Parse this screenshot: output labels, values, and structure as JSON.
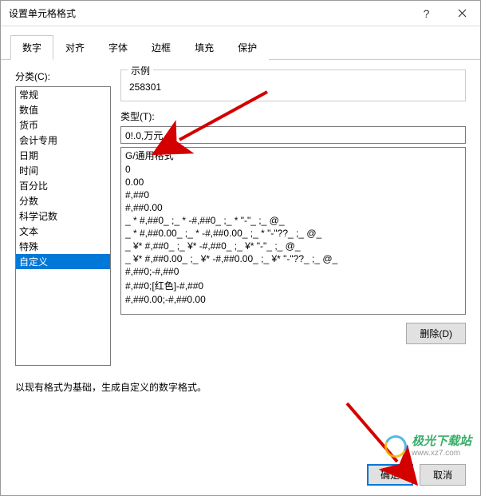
{
  "titlebar": {
    "title": "设置单元格格式"
  },
  "tabs": [
    {
      "label": "数字"
    },
    {
      "label": "对齐"
    },
    {
      "label": "字体"
    },
    {
      "label": "边框"
    },
    {
      "label": "填充"
    },
    {
      "label": "保护"
    }
  ],
  "category": {
    "label": "分类(C):",
    "items": [
      "常规",
      "数值",
      "货币",
      "会计专用",
      "日期",
      "时间",
      "百分比",
      "分数",
      "科学记数",
      "文本",
      "特殊",
      "自定义"
    ],
    "selected_index": 11
  },
  "sample": {
    "label": "示例",
    "value": "258301"
  },
  "type": {
    "label": "类型(T):",
    "value": "0!.0,万元"
  },
  "formats": [
    "G/通用格式",
    "0",
    "0.00",
    "#,##0",
    "#,##0.00",
    "_ * #,##0_ ;_ * -#,##0_ ;_ * \"-\"_ ;_ @_ ",
    "_ * #,##0.00_ ;_ * -#,##0.00_ ;_ * \"-\"??_ ;_ @_ ",
    "_ ¥* #,##0_ ;_ ¥* -#,##0_ ;_ ¥* \"-\"_ ;_ @_ ",
    "_ ¥* #,##0.00_ ;_ ¥* -#,##0.00_ ;_ ¥* \"-\"??_ ;_ @_ ",
    "#,##0;-#,##0",
    "#,##0;[红色]-#,##0",
    "#,##0.00;-#,##0.00"
  ],
  "buttons": {
    "delete": "删除(D)",
    "ok": "确定",
    "cancel": "取消"
  },
  "hint": "以现有格式为基础，生成自定义的数字格式。",
  "watermark": {
    "cn": "极光下载站",
    "en": "www.xz7.com"
  }
}
